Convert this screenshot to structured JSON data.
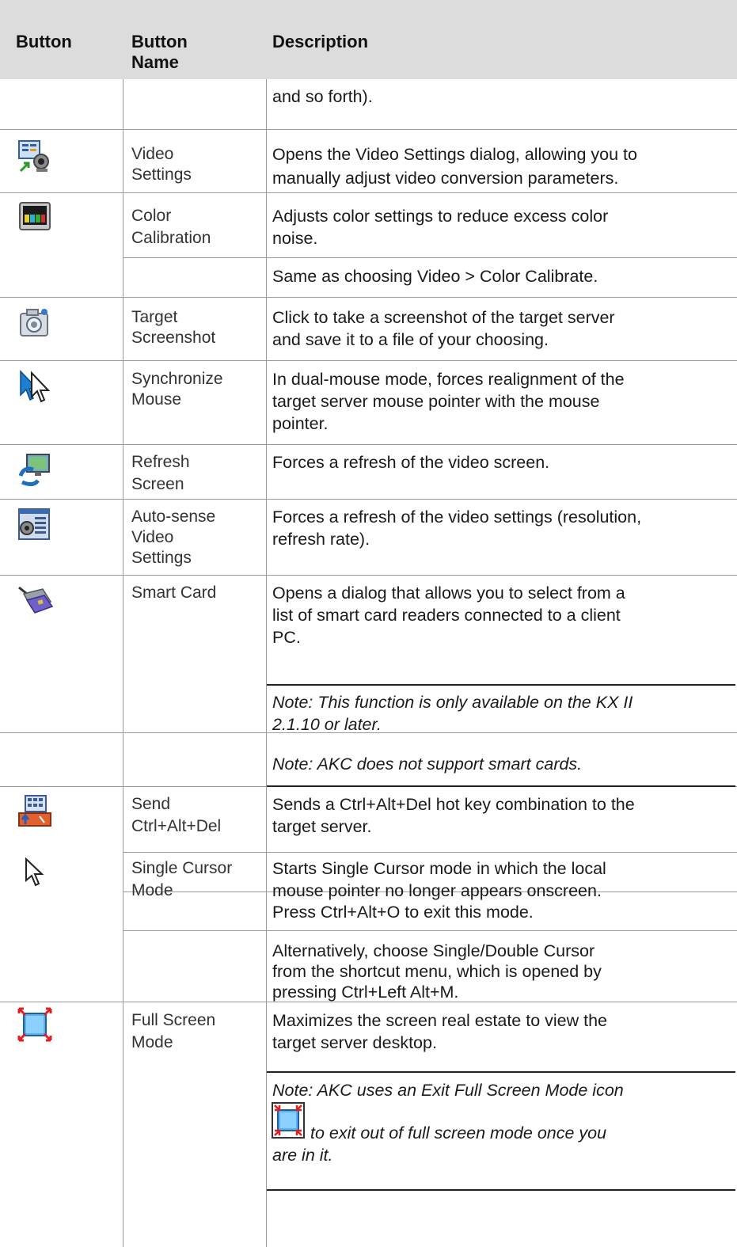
{
  "header": {
    "col_button": "Button",
    "col_name": "Button Name",
    "col_desc": "Description"
  },
  "rows": [
    {
      "name": [],
      "desc": [
        "and so forth)."
      ],
      "icon": ""
    },
    {
      "name": [
        "Video",
        "Settings"
      ],
      "desc": [
        "Opens the Video Settings dialog, allowing you to",
        "manually adjust video conversion parameters."
      ],
      "icon": "video-settings-icon"
    },
    {
      "name": [
        "Color",
        "Calibration"
      ],
      "desc": [
        "Adjusts color settings to reduce excess color",
        "noise."
      ],
      "desc2": [
        "Same as choosing Video > Color Calibrate."
      ],
      "icon": "color-calibration-icon"
    },
    {
      "name": [
        "Target",
        "Screenshot"
      ],
      "desc": [
        "Click to take a screenshot of the target server",
        "and save it to a file of your choosing."
      ],
      "icon": "camera-icon"
    },
    {
      "name": [
        "Synchronize",
        "Mouse"
      ],
      "desc": [
        "In dual-mouse mode, forces realignment of the",
        "target server mouse pointer with the mouse",
        "pointer."
      ],
      "icon": "sync-mouse-icon"
    },
    {
      "name": [
        "Refresh",
        "Screen"
      ],
      "desc": [
        "Forces a refresh of the video screen."
      ],
      "icon": "refresh-screen-icon"
    },
    {
      "name": [
        "Auto-sense",
        "Video",
        "Settings"
      ],
      "desc": [
        "Forces a refresh of the video settings (resolution,",
        "refresh rate)."
      ],
      "icon": "auto-sense-icon"
    },
    {
      "name": [
        "Smart Card"
      ],
      "desc": [
        "Opens a dialog that allows you to select from a",
        "list of smart card readers connected to a client",
        "PC."
      ],
      "notes": [
        "Note: This function is only available on the KX II",
        "2.1.10 or later.",
        "Note: AKC does not support smart cards."
      ],
      "icon": "smart-card-icon"
    },
    {
      "name": [
        "Send",
        "Ctrl+Alt+Del"
      ],
      "desc": [
        "Sends a Ctrl+Alt+Del hot key combination to the",
        "target server."
      ],
      "icon": "keyboard-icon"
    },
    {
      "name": [
        "Single Cursor",
        "Mode"
      ],
      "desc": [
        "Starts Single Cursor mode in which the local",
        "mouse pointer no longer appears onscreen.",
        "Press Ctrl+Alt+O to exit this mode.",
        "Alternatively, choose Single/Double Cursor",
        "from the shortcut menu, which is opened by",
        "pressing Ctrl+Left Alt+M."
      ],
      "icon": "cursor-icon"
    },
    {
      "name": [
        "Full Screen",
        "Mode"
      ],
      "desc": [
        "Maximizes the screen real estate to view the",
        "target server desktop."
      ],
      "notes": [
        "Note: AKC uses an Exit Full Screen Mode icon",
        "to exit out of full screen mode once you",
        "are in it."
      ],
      "icon": "full-screen-icon"
    }
  ]
}
